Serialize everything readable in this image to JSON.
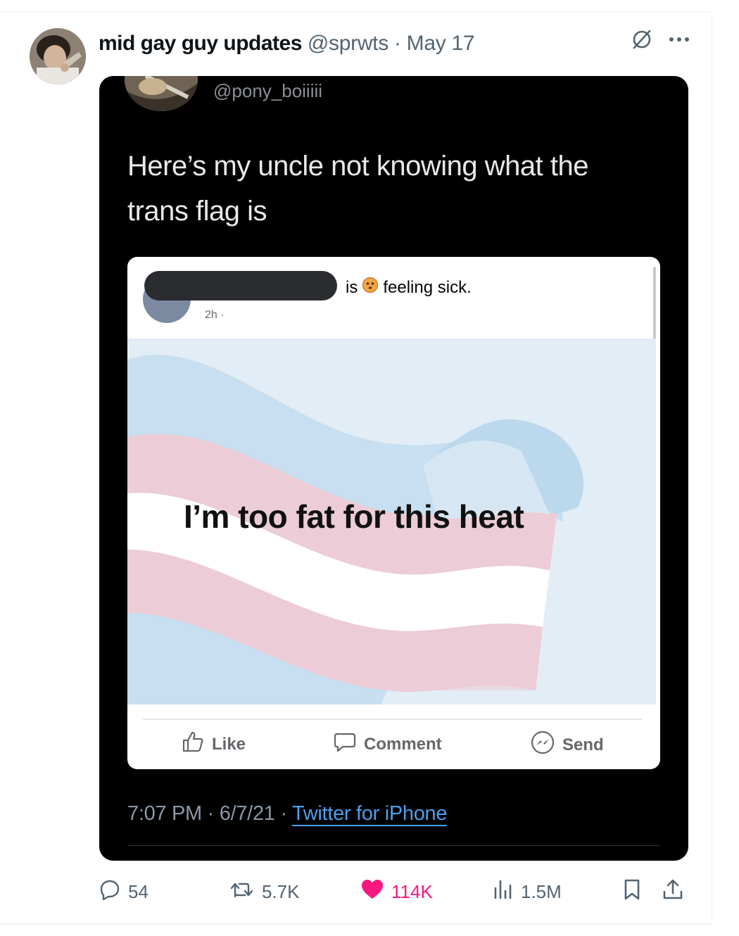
{
  "tweet": {
    "display_name": "mid gay guy updates",
    "handle_date": "@sprwts · May 17",
    "icons": {
      "grok": "grok-icon",
      "more": "more-icon"
    }
  },
  "quoted": {
    "handle": "@pony_boiiiii",
    "text_line1": "Here’s my uncle not knowing what the",
    "text_line2": "trans flag is",
    "meta_prefix": "7:07 PM · 6/7/21 · ",
    "meta_source": "Twitter for iPhone",
    "facebook_post": {
      "status_is": "is",
      "status_feeling": "feeling sick.",
      "time": "2h ·",
      "image_caption": "I’m too fat for this heat",
      "like_label": "Like",
      "comment_label": "Comment",
      "send_label": "Send"
    }
  },
  "actions": {
    "replies": "54",
    "retweets": "5.7K",
    "likes": "114K",
    "views": "1.5M",
    "liked": true,
    "like_color": "#f91880"
  }
}
